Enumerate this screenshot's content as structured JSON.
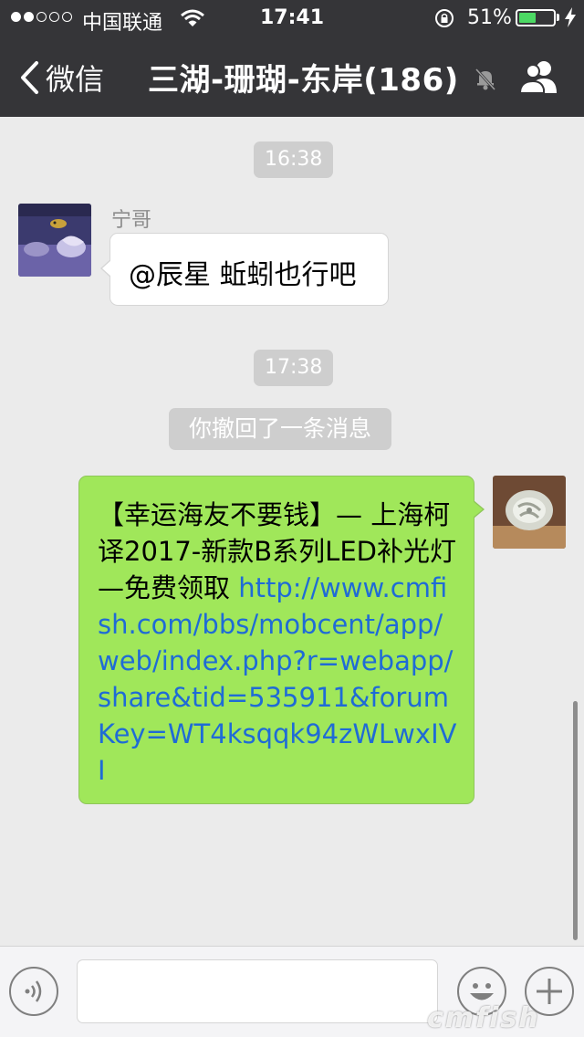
{
  "status_bar": {
    "carrier": "中国联通",
    "time": "17:41",
    "battery_percent": "51%",
    "battery_level": 0.51,
    "battery_color": "#4cd964",
    "signal_bars": 2
  },
  "nav": {
    "back_label": "微信",
    "title": "三湖-珊瑚-东岸(186)",
    "icons": [
      "chevron-left-icon",
      "mute-bell-icon",
      "group-members-icon"
    ]
  },
  "messages": {
    "time1": "16:38",
    "incoming": {
      "sender": "宁哥",
      "text": "@辰星 蚯蚓也行吧"
    },
    "time2": "17:38",
    "recall_notice": "你撤回了一条消息",
    "outgoing": {
      "text": "【幸运海友不要钱】— 上海柯译2017-新款B系列LED补光灯—免费领取 ",
      "link": "http://www.cmfish.com/bbs/mobcent/app/web/index.php?r=webapp/share&tid=535911&forumKey=WT4ksqqk94zWLwxIVI"
    }
  },
  "input_bar": {
    "icons": [
      "voice-icon",
      "emoji-icon",
      "plus-icon"
    ]
  },
  "watermark": "cmfish",
  "colors": {
    "nav_bg": "#353538",
    "chat_bg": "#ebebeb",
    "outgoing_bubble": "#a0e75a",
    "link": "#1f6bd6"
  }
}
